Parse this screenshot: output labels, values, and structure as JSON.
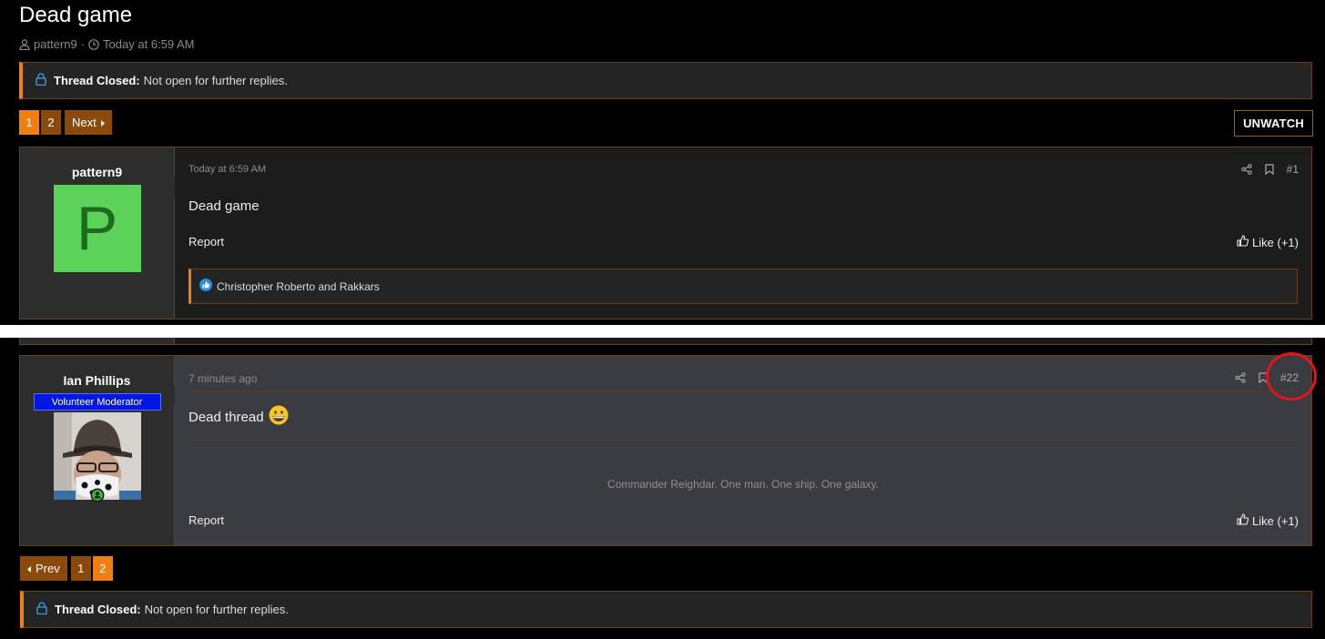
{
  "thread": {
    "title": "Dead game",
    "author": "pattern9",
    "separator": "·",
    "date": "Today at 6:59 AM"
  },
  "notice": {
    "label": "Thread Closed:",
    "text": "Not open for further replies."
  },
  "pagination_top": {
    "pages": [
      "1",
      "2"
    ],
    "current": "1",
    "next_label": "Next"
  },
  "pagination_bottom": {
    "prev_label": "Prev",
    "pages": [
      "1",
      "2"
    ],
    "current": "2"
  },
  "watch_button": "UNWATCH",
  "posts": [
    {
      "username": "pattern9",
      "avatar_letter": "P",
      "date": "Today at 6:59 AM",
      "number": "#1",
      "text": "Dead game",
      "report": "Report",
      "like": "Like (+1)",
      "reactions": "Christopher Roberto and Rakkars"
    },
    {
      "username": "Ian Phillips",
      "role": "Volunteer Moderator",
      "date": "7 minutes ago",
      "number": "#22",
      "text": "Dead thread",
      "emoji": "😀",
      "signature": "Commander Reighdar. One man. One ship. One galaxy.",
      "report": "Report",
      "like": "Like (+1)"
    }
  ],
  "colors": {
    "accent": "#f07f10",
    "accent_dark": "#8a4a0c",
    "border": "#6a3f14",
    "annotation": "#e0161b"
  }
}
